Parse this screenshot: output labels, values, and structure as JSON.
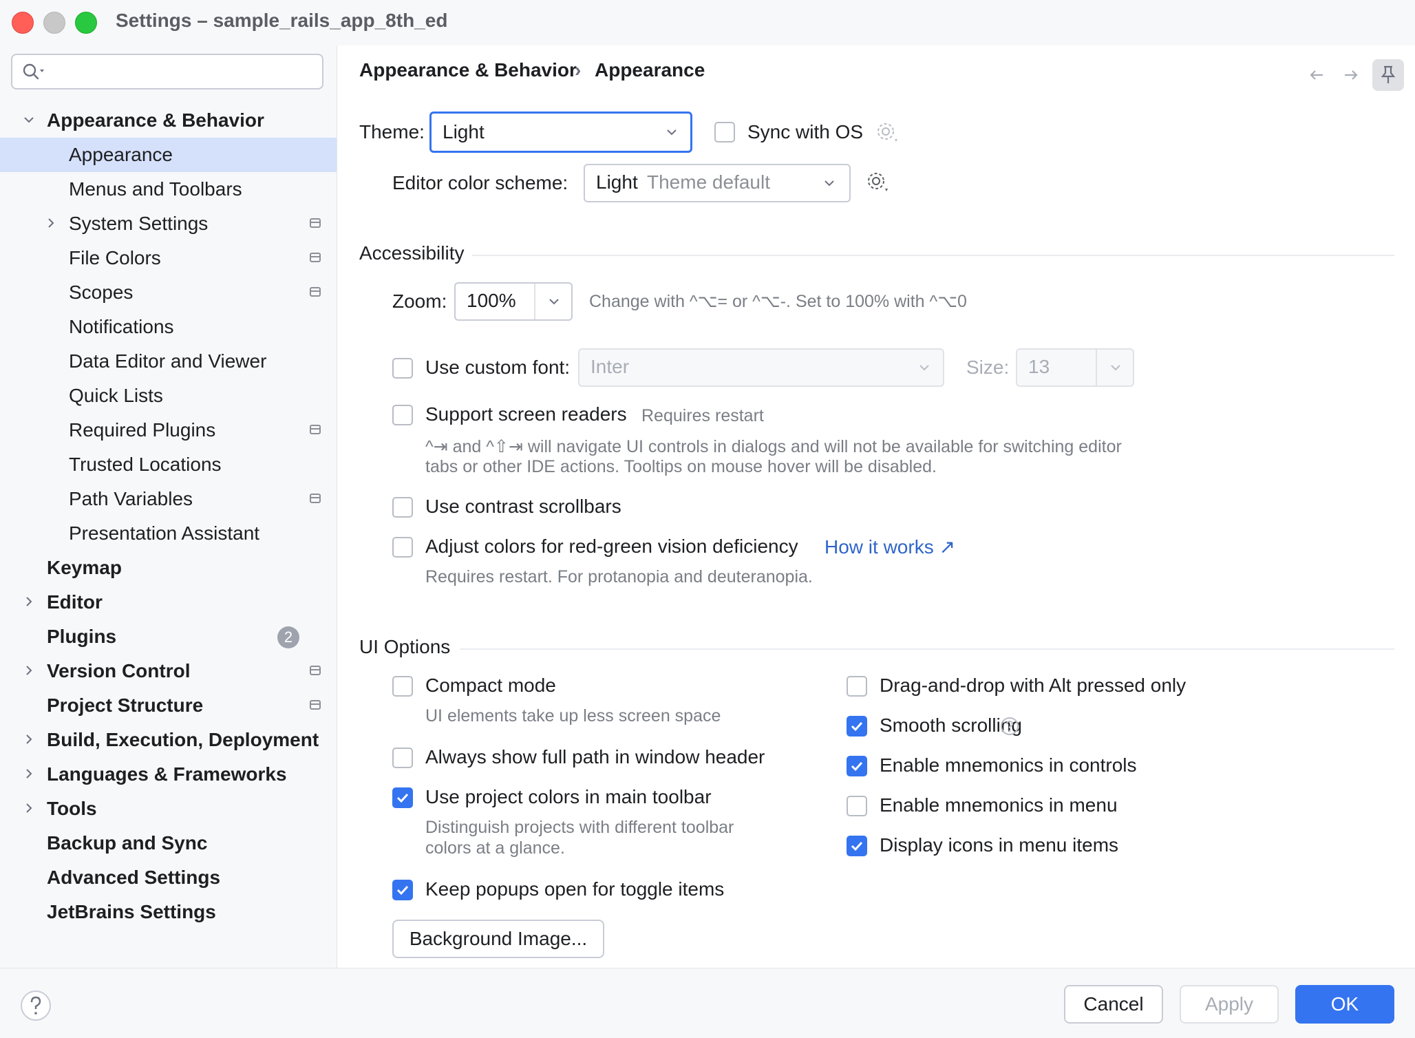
{
  "window": {
    "title": "Settings – sample_rails_app_8th_ed"
  },
  "search": {
    "placeholder": ""
  },
  "sidebar": {
    "items": [
      {
        "label": "Appearance & Behavior",
        "bold": true
      },
      {
        "label": "Appearance",
        "selected": true
      },
      {
        "label": "Menus and Toolbars"
      },
      {
        "label": "System Settings"
      },
      {
        "label": "File Colors"
      },
      {
        "label": "Scopes"
      },
      {
        "label": "Notifications"
      },
      {
        "label": "Data Editor and Viewer"
      },
      {
        "label": "Quick Lists"
      },
      {
        "label": "Required Plugins"
      },
      {
        "label": "Trusted Locations"
      },
      {
        "label": "Path Variables"
      },
      {
        "label": "Presentation Assistant"
      },
      {
        "label": "Keymap",
        "bold": true
      },
      {
        "label": "Editor",
        "bold": true
      },
      {
        "label": "Plugins",
        "bold": true,
        "badge": "2"
      },
      {
        "label": "Version Control",
        "bold": true
      },
      {
        "label": "Project Structure",
        "bold": true
      },
      {
        "label": "Build, Execution, Deployment",
        "bold": true
      },
      {
        "label": "Languages & Frameworks",
        "bold": true
      },
      {
        "label": "Tools",
        "bold": true
      },
      {
        "label": "Backup and Sync",
        "bold": true
      },
      {
        "label": "Advanced Settings",
        "bold": true
      },
      {
        "label": "JetBrains Settings",
        "bold": true
      }
    ]
  },
  "breadcrumb": {
    "parent": "Appearance & Behavior",
    "separator": "›",
    "current": "Appearance"
  },
  "theme": {
    "label": "Theme:",
    "value": "Light",
    "sync_label": "Sync with OS",
    "sync_checked": false
  },
  "editor_scheme": {
    "label": "Editor color scheme:",
    "value": "Light",
    "value_hint": "Theme default"
  },
  "accessibility": {
    "title": "Accessibility",
    "zoom_label": "Zoom:",
    "zoom_value": "100%",
    "zoom_hint": "Change with ^⌥= or ^⌥-. Set to 100% with ^⌥0",
    "custom_font_label": "Use custom font:",
    "custom_font_checked": false,
    "font_value": "Inter",
    "size_label": "Size:",
    "size_value": "13",
    "screen_readers_label": "Support screen readers",
    "screen_readers_checked": false,
    "screen_readers_hint": "Requires restart",
    "screen_readers_desc_1": "^⇥ and ^⇧⇥ will navigate UI controls in dialogs and will not be available for switching editor",
    "screen_readers_desc_2": "tabs or other IDE actions. Tooltips on mouse hover will be disabled.",
    "contrast_scrollbars_label": "Use contrast scrollbars",
    "contrast_scrollbars_checked": false,
    "red_green_label": "Adjust colors for red-green vision deficiency",
    "red_green_checked": false,
    "how_it_works": "How it works ↗",
    "red_green_desc": "Requires restart. For protanopia and deuteranopia."
  },
  "ui_options": {
    "title": "UI Options",
    "compact_mode": {
      "label": "Compact mode",
      "checked": false,
      "desc": "UI elements take up less screen space"
    },
    "full_path": {
      "label": "Always show full path in window header",
      "checked": false
    },
    "project_colors": {
      "label": "Use project colors in main toolbar",
      "checked": true,
      "desc_1": "Distinguish projects with different toolbar",
      "desc_2": "colors at a glance."
    },
    "keep_popups": {
      "label": "Keep popups open for toggle items",
      "checked": true
    },
    "background_image_button": "Background Image...",
    "drag_drop": {
      "label": "Drag-and-drop with Alt pressed only",
      "checked": false
    },
    "smooth_scrolling": {
      "label": "Smooth scrolling",
      "checked": true
    },
    "mnemonics_controls": {
      "label": "Enable mnemonics in controls",
      "checked": true
    },
    "mnemonics_menu": {
      "label": "Enable mnemonics in menu",
      "checked": false
    },
    "icons_menu": {
      "label": "Display icons in menu items",
      "checked": true
    }
  },
  "footer": {
    "cancel": "Cancel",
    "apply": "Apply",
    "ok": "OK"
  },
  "colors": {
    "accent": "#3574f0",
    "selection": "#d5e1fb",
    "link": "#2f65ca"
  },
  "icons": [
    "search-icon",
    "gear-icon",
    "back-arrow-icon",
    "forward-arrow-icon",
    "pin-icon",
    "help-icon",
    "question-icon",
    "chevron-down-icon",
    "chevron-right-icon",
    "external-link-icon",
    "checkmark-icon"
  ]
}
